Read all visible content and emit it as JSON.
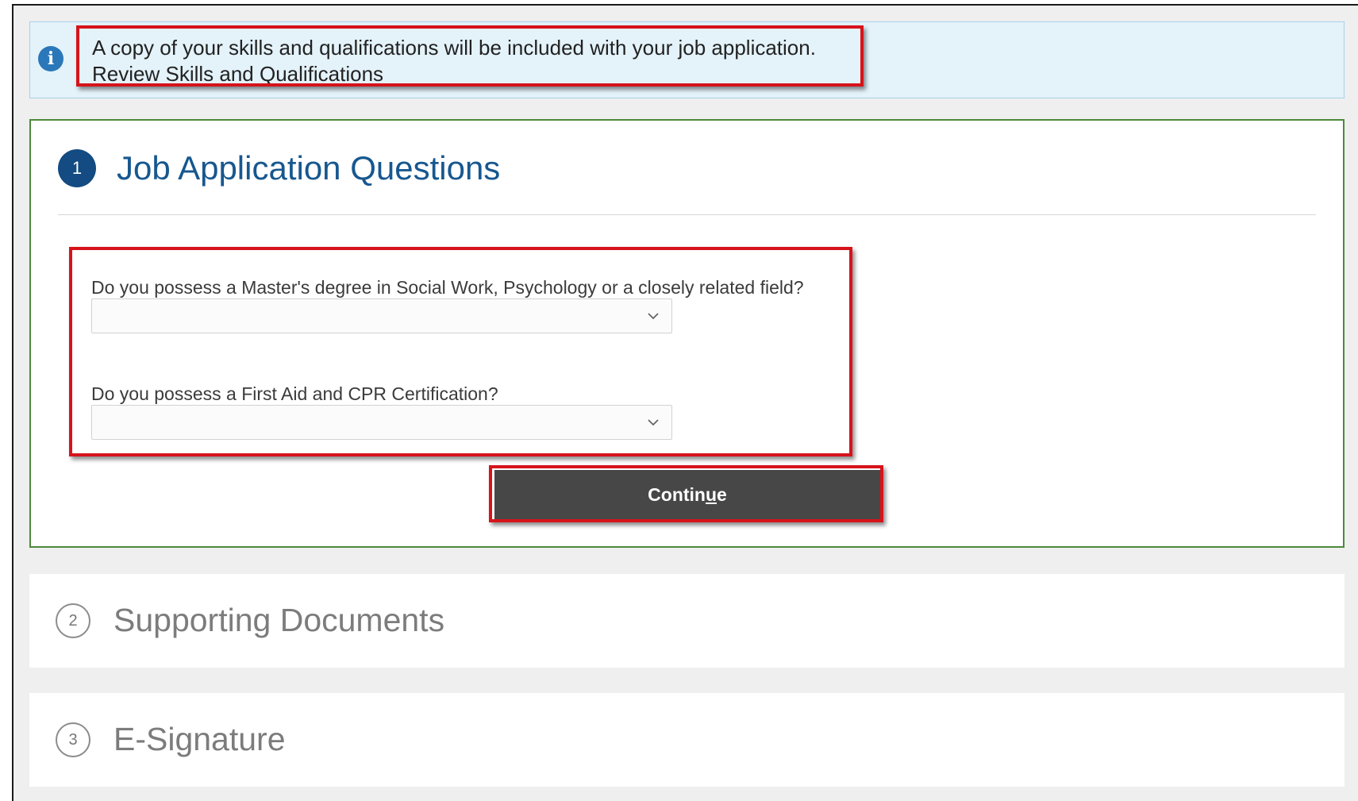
{
  "info": {
    "message": "A copy of your skills and qualifications will be included with your job application.",
    "link": "Review Skills and Qualifications",
    "icon": "info-icon"
  },
  "steps": [
    {
      "number": "1",
      "title": "Job Application Questions",
      "state": "active"
    },
    {
      "number": "2",
      "title": "Supporting Documents",
      "state": "collapsed"
    },
    {
      "number": "3",
      "title": "E-Signature",
      "state": "collapsed"
    }
  ],
  "questions": [
    {
      "label": "Do you possess a Master's degree in Social Work, Psychology or a closely related field?",
      "value": ""
    },
    {
      "label": "Do you possess a First Aid and CPR Certification?",
      "value": ""
    }
  ],
  "buttons": {
    "continue": {
      "pre": "Contin",
      "mnemonic": "u",
      "post": "e"
    }
  },
  "colors": {
    "accent_blue": "#17578f",
    "active_border": "#4c8a3c",
    "highlight_red": "#d6131b",
    "button_bg": "#474747"
  }
}
